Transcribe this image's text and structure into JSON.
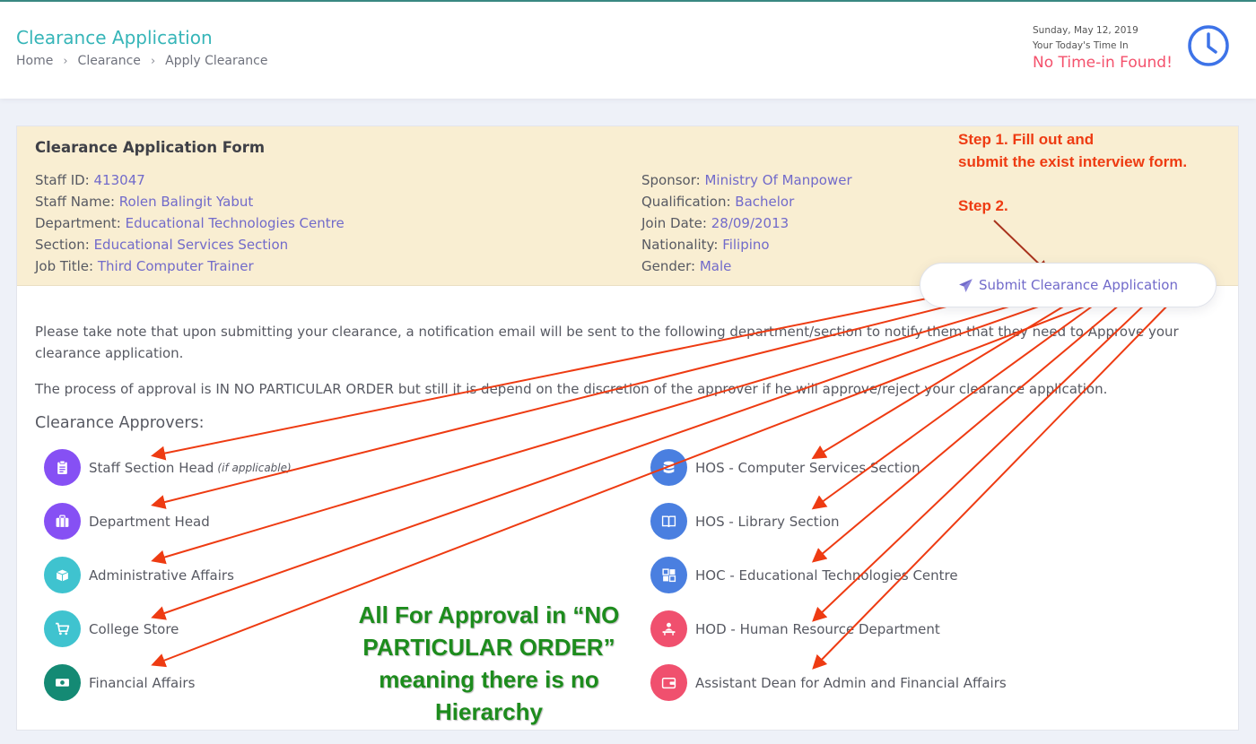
{
  "header": {
    "title": "Clearance Application",
    "breadcrumb": [
      "Home",
      "Clearance",
      "Apply Clearance"
    ],
    "date": "Sunday, May 12, 2019",
    "time_label": "Your Today's Time In",
    "time_status": "No Time-in Found!",
    "clock_icon": "clock-icon"
  },
  "form": {
    "title": "Clearance Application Form",
    "left": [
      {
        "label": "Staff ID:",
        "value": "413047"
      },
      {
        "label": "Staff Name:",
        "value": "Rolen Balingit Yabut"
      },
      {
        "label": "Department:",
        "value": "Educational Technologies Centre"
      },
      {
        "label": "Section:",
        "value": "Educational Services Section"
      },
      {
        "label": "Job Title:",
        "value": "Third Computer Trainer"
      }
    ],
    "right": [
      {
        "label": "Sponsor:",
        "value": "Ministry Of Manpower"
      },
      {
        "label": "Qualification:",
        "value": "Bachelor"
      },
      {
        "label": "Join Date:",
        "value": "28/09/2013"
      },
      {
        "label": "Nationality:",
        "value": "Filipino"
      },
      {
        "label": "Gender:",
        "value": "Male"
      }
    ],
    "submit_label": "Submit Clearance Application"
  },
  "notes": {
    "p1": "Please take note that upon submitting your clearance, a notification email will be sent to the following department/section to notify them that they need to Approve your clearance application.",
    "p2_before": "The process of approval is ",
    "p2_emph": "IN NO PARTICULAR ORDER",
    "p2_after": " but still it is depend on the discretion of the approver if he will approve/reject your clearance application."
  },
  "approvers": {
    "title": "Clearance Approvers:",
    "items": [
      {
        "label": "Staff Section Head",
        "note": "(if applicable)",
        "icon": "clipboard-icon",
        "color": "#8650f4"
      },
      {
        "label": "Department Head",
        "note": "",
        "icon": "briefcase-icon",
        "color": "#8650f4"
      },
      {
        "label": "Administrative Affairs",
        "note": "",
        "icon": "box-icon",
        "color": "#3fc3cf"
      },
      {
        "label": "College Store",
        "note": "",
        "icon": "cart-icon",
        "color": "#3fc3cf"
      },
      {
        "label": "Financial Affairs",
        "note": "",
        "icon": "money-icon",
        "color": "#148a74"
      },
      {
        "label": "HOS - Computer Services Section",
        "note": "",
        "icon": "database-icon",
        "color": "#4a7fe0"
      },
      {
        "label": "HOS - Library Section",
        "note": "",
        "icon": "book-icon",
        "color": "#4a7fe0"
      },
      {
        "label": "HOC - Educational Technologies Centre",
        "note": "",
        "icon": "windows-icon",
        "color": "#4a7fe0"
      },
      {
        "label": "HOD - Human Resource Department",
        "note": "",
        "icon": "person-desk-icon",
        "color": "#f0506e"
      },
      {
        "label": "Assistant Dean for Admin and Financial Affairs",
        "note": "",
        "icon": "wallet-icon",
        "color": "#f0506e"
      }
    ]
  },
  "annotations": {
    "step1_line1": "Step 1. Fill out and",
    "step1_line2": "submit the exist interview form.",
    "step2": "Step 2.",
    "green_note": "All For Approval in “NO PARTICULAR ORDER” meaning there is no Hierarchy",
    "arrow_color": "#ee3b12",
    "green_color": "#1d8c1d"
  }
}
